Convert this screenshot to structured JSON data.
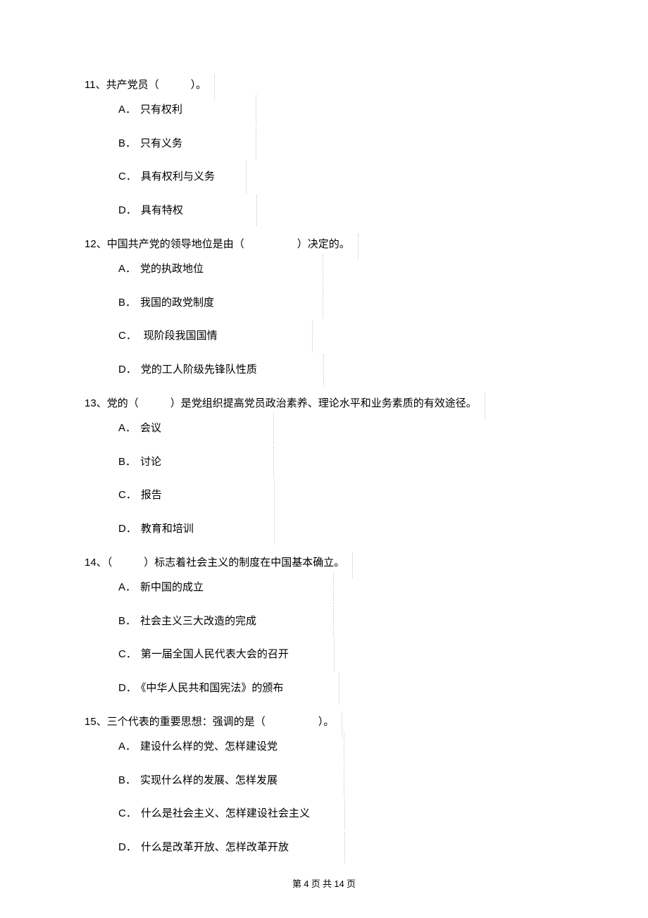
{
  "q11": {
    "num": "11",
    "sep": "、",
    "stem_before": "共产党员（",
    "stem_after": "）。",
    "A": "只有权利",
    "B": "只有义务",
    "C": "具有权利与义务",
    "D": "具有特权"
  },
  "q12": {
    "num": "12",
    "sep": "、",
    "stem_before": "中国共产党的领导地位是由（",
    "stem_after": "）决定的。",
    "A": "党的执政地位",
    "B": "我国的政党制度",
    "C": "   现阶段我国国情",
    "D": "党的工人阶级先锋队性质"
  },
  "q13": {
    "num": "13",
    "sep": "、",
    "stem_before": "党的（",
    "stem_after": "）是党组织提高党员政治素养、理论水平和业务素质的有效途径。",
    "A": "会议",
    "B": "讨论",
    "C": "报告",
    "D": "教育和培训"
  },
  "q14": {
    "num": "14",
    "sep": "、",
    "stem_before": "（",
    "stem_after": "）标志着社会主义的制度在中国基本确立。",
    "A": "新中国的成立",
    "B": "社会主义三大改造的完成",
    "C": "第一届全国人民代表大会的召开",
    "D": "《中华人民共和国宪法》的颁布"
  },
  "q15": {
    "num": "15",
    "sep": "、",
    "stem_before": "三个代表的重要思想：强调的是（",
    "stem_after": "）。",
    "A": "建设什么样的党、怎样建设党",
    "B": "实现什么样的发展、怎样发展",
    "C": "什么是社会主义、怎样建设社会主义",
    "D": "什么是改革开放、怎样改革开放"
  },
  "footer": {
    "p1": "第 ",
    "cur": "4",
    "p2": " 页 共 ",
    "tot": "14",
    "p3": " 页"
  },
  "letters": {
    "A": "A．",
    "B": "B．",
    "C": "C．",
    "D": "D．"
  },
  "blank_short": "　　　",
  "blank_long": "　　　　　"
}
